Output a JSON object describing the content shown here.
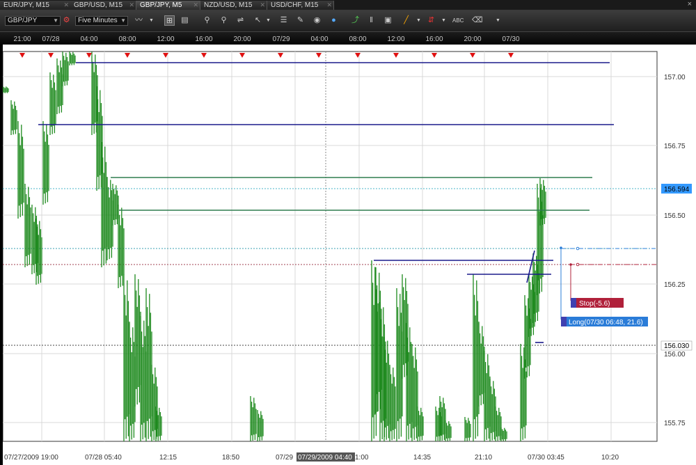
{
  "tabs": [
    {
      "label": "EUR/JPY, M15",
      "active": false
    },
    {
      "label": "GBP/USD, M15",
      "active": false
    },
    {
      "label": "GBP/JPY, M5",
      "active": true
    },
    {
      "label": "NZD/USD, M15",
      "active": false
    },
    {
      "label": "USD/CHF, M15",
      "active": false
    }
  ],
  "window_close": "×",
  "toolbar": {
    "symbol": "GBP/JPY",
    "timeframe": "Five Minutes"
  },
  "top_axis_labels": [
    "21:00",
    "07/28",
    "04:00",
    "08:00",
    "12:00",
    "16:00",
    "20:00",
    "07/29",
    "04:00",
    "08:00",
    "12:00",
    "16:00",
    "20:00",
    "07/30"
  ],
  "bottom_axis_labels": [
    "07/27/2009 19:00",
    "07/28 05:40",
    "12:15",
    "18:50",
    "07/29",
    "07/29/2009 04:40",
    "1:00",
    "14:35",
    "21:10",
    "07/30 03:45",
    "10:20"
  ],
  "price_axis": {
    "ticks": [
      "157.00",
      "156.75",
      "156.50",
      "156.25",
      "156.00",
      "155.75"
    ],
    "current_price": "156.594",
    "low_marker": "156.030"
  },
  "orders": {
    "stop_label": "Stop(-5.6)",
    "long_label": "Long(07/30 06:48, 21.6)"
  },
  "colors": {
    "background": "#ffffff",
    "candles": "#1e8a1e",
    "blue_lines": "#1a1a8c",
    "green_lines": "#2e7d4f",
    "current_price_box": "#3399ff",
    "stop_box": "#b0203a",
    "long_box": "#2a7cd8",
    "event_markers": "#e01010"
  }
}
